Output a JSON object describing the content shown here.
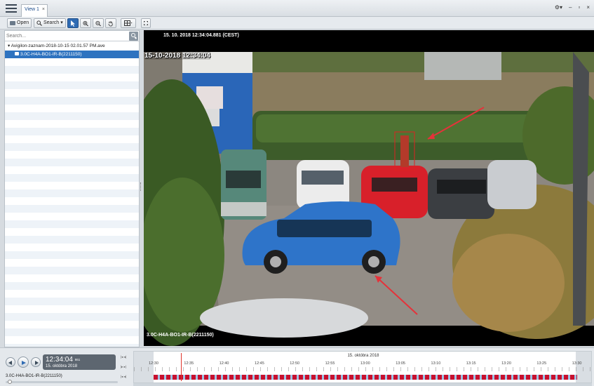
{
  "titlebar": {
    "tab_label": "View 1",
    "tab_close": "×",
    "win_settings": "⚙▾",
    "win_min": "–",
    "win_restore": "▫",
    "win_close": "×"
  },
  "toolbar": {
    "open_label": "Open",
    "search_label": "Search",
    "search_caret": "▾"
  },
  "sidebar": {
    "search_placeholder": "Search...",
    "tree_root": "▾  Avigilon-zaznam-2018-10-15 02.01.57 PM.ave",
    "tree_item": "3.0C-H4A-BO1-IR-B(2211150)"
  },
  "video": {
    "header_timestamp": "15. 10. 2018 12:34:04.881 (CEST)",
    "overlay_timestamp": "15-10-2018 12:34:04",
    "camera_label": "3.0C-H4A-BO1-IR-B(2211150)"
  },
  "timeline": {
    "clock_time": "12:34:04",
    "clock_suffix": "861",
    "clock_date": "15. októbra 2018",
    "timeline_date": "15. októbra 2018",
    "camera_label": "3.0C-H4A-BO1-IR-B(2211150)",
    "skip_back": "|◂ ◂|",
    "skip_fwd": "|▸ ▸|",
    "tick_labels": [
      "12:30",
      "12:35",
      "12:40",
      "12:45",
      "12:50",
      "12:55",
      "13:00",
      "13:05",
      "13:10",
      "13:15",
      "13:20",
      "13:25",
      "13:30"
    ],
    "recording_color": "#c8102e",
    "gap_color": "#9ec3e6"
  }
}
